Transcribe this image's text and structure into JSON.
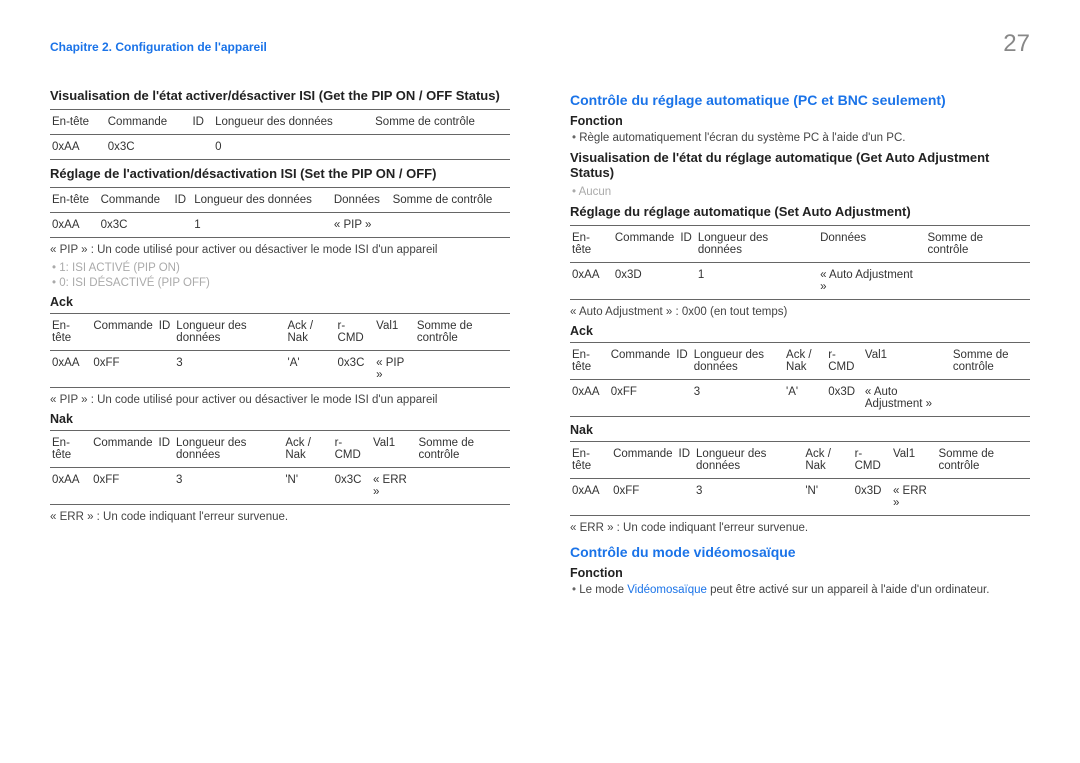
{
  "header": {
    "chapter": "Chapitre 2. Configuration de l'appareil",
    "page_number": "27"
  },
  "left": {
    "sec1": {
      "title": "Visualisation de l'état activer/désactiver ISI (Get the PIP ON / OFF Status)",
      "table": {
        "headers": [
          "En-tête",
          "Commande",
          "ID",
          "Longueur des données",
          "Somme de contrôle"
        ],
        "row": [
          "0xAA",
          "0x3C",
          "",
          "0",
          ""
        ]
      }
    },
    "sec2": {
      "title": "Réglage de l'activation/désactivation ISI (Set the PIP ON / OFF)",
      "table": {
        "headers": [
          "En-tête",
          "Commande",
          "ID",
          "Longueur des données",
          "Données",
          "Somme de contrôle"
        ],
        "row": [
          "0xAA",
          "0x3C",
          "",
          "1",
          "« PIP »",
          ""
        ]
      },
      "note1": "« PIP » : Un code utilisé pour activer ou désactiver le mode ISI d'un appareil",
      "bullet1": "1: ISI ACTIVÉ (PIP ON)",
      "bullet2": "0: ISI DÉSACTIVÉ (PIP OFF)"
    },
    "ack": {
      "title": "Ack",
      "table": {
        "headers": [
          "En-tête",
          "Commande",
          "ID",
          "Longueur des données",
          "Ack / Nak",
          "r-CMD",
          "Val1",
          "Somme de contrôle"
        ],
        "row": [
          "0xAA",
          "0xFF",
          "",
          "3",
          "'A'",
          "0x3C",
          "« PIP »",
          ""
        ]
      },
      "note": "« PIP » : Un code utilisé pour activer ou désactiver le mode ISI d'un appareil"
    },
    "nak": {
      "title": "Nak",
      "table": {
        "headers": [
          "En-tête",
          "Commande",
          "ID",
          "Longueur des données",
          "Ack / Nak",
          "r-CMD",
          "Val1",
          "Somme de contrôle"
        ],
        "row": [
          "0xAA",
          "0xFF",
          "",
          "3",
          "'N'",
          "0x3C",
          "« ERR »",
          ""
        ]
      },
      "note": "« ERR » : Un code indiquant l'erreur survenue."
    }
  },
  "right": {
    "sec1": {
      "h3": "Contrôle du réglage automatique (PC et BNC seulement)",
      "fonction_label": "Fonction",
      "bullet1": "Règle automatiquement l'écran du système PC à l'aide d'un PC.",
      "title2": "Visualisation de l'état du réglage automatique (Get Auto Adjustment Status)",
      "bullet_aucun": "Aucun",
      "title3": "Réglage du réglage automatique (Set Auto Adjustment)",
      "table": {
        "headers": [
          "En-tête",
          "Commande",
          "ID",
          "Longueur des données",
          "Données",
          "Somme de contrôle"
        ],
        "row": [
          "0xAA",
          "0x3D",
          "",
          "1",
          "« Auto Adjustment »",
          ""
        ]
      },
      "note": "« Auto Adjustment » : 0x00 (en tout temps)"
    },
    "ack": {
      "title": "Ack",
      "table": {
        "headers": [
          "En-tête",
          "Commande",
          "ID",
          "Longueur des données",
          "Ack / Nak",
          "r-CMD",
          "Val1",
          "Somme de contrôle"
        ],
        "row": [
          "0xAA",
          "0xFF",
          "",
          "3",
          "'A'",
          "0x3D",
          "« Auto Adjustment »",
          ""
        ]
      }
    },
    "nak": {
      "title": "Nak",
      "table": {
        "headers": [
          "En-tête",
          "Commande",
          "ID",
          "Longueur des données",
          "Ack / Nak",
          "r-CMD",
          "Val1",
          "Somme de contrôle"
        ],
        "row": [
          "0xAA",
          "0xFF",
          "",
          "3",
          "'N'",
          "0x3D",
          "« ERR »",
          ""
        ]
      },
      "note": "« ERR » : Un code indiquant l'erreur survenue."
    },
    "sec2": {
      "h3": "Contrôle du mode vidéomosaïque",
      "fonction_label": "Fonction",
      "bullet_pre": "Le mode ",
      "bullet_link": "Vidéomosaïque",
      "bullet_post": " peut être activé sur un appareil à l'aide d'un ordinateur."
    }
  }
}
